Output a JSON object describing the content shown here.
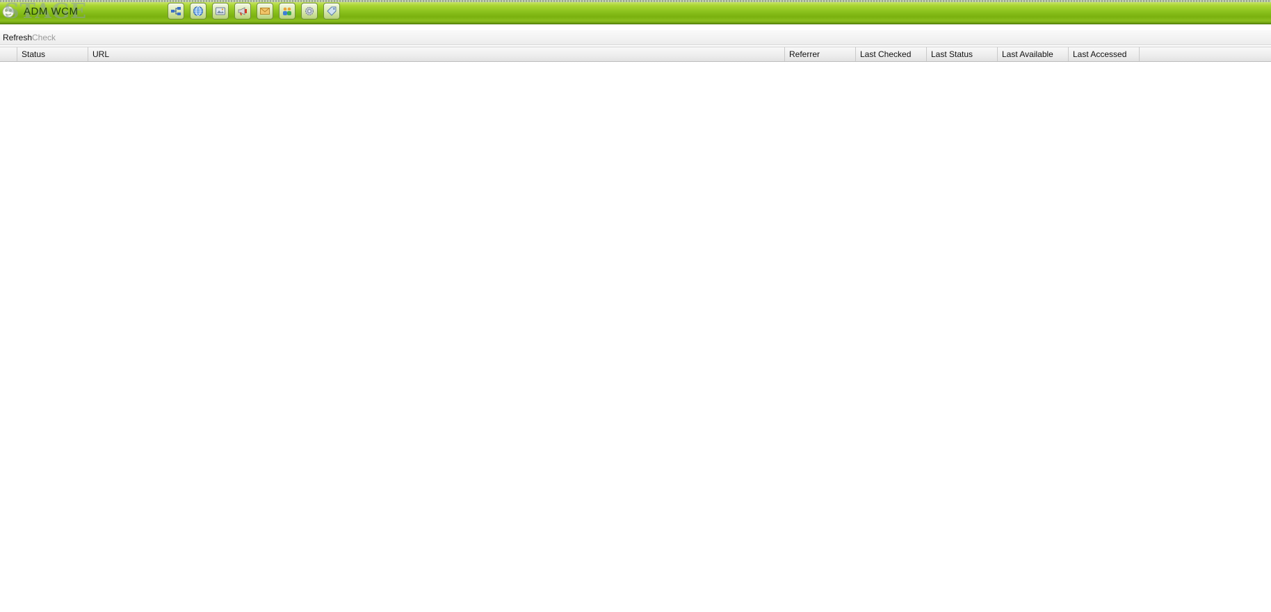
{
  "header": {
    "logo_watermark": "STAGE",
    "logo_brand": "ADM WCM",
    "icons": [
      "sitemap-icon",
      "globe-icon",
      "media-icon",
      "announcement-icon",
      "mail-icon",
      "users-icon",
      "settings-icon",
      "tag-icon"
    ]
  },
  "actions": {
    "refresh_label": "Refresh",
    "check_label": "Check"
  },
  "grid": {
    "columns": [
      "",
      "Status",
      "URL",
      "Referrer",
      "Last Checked",
      "Last Status",
      "Last Available",
      "Last Accessed"
    ],
    "rows": []
  },
  "colors": {
    "header_green": "#8cc31f",
    "header_dark_green": "#5c8a0a",
    "disabled_text": "#9a9a9a"
  }
}
